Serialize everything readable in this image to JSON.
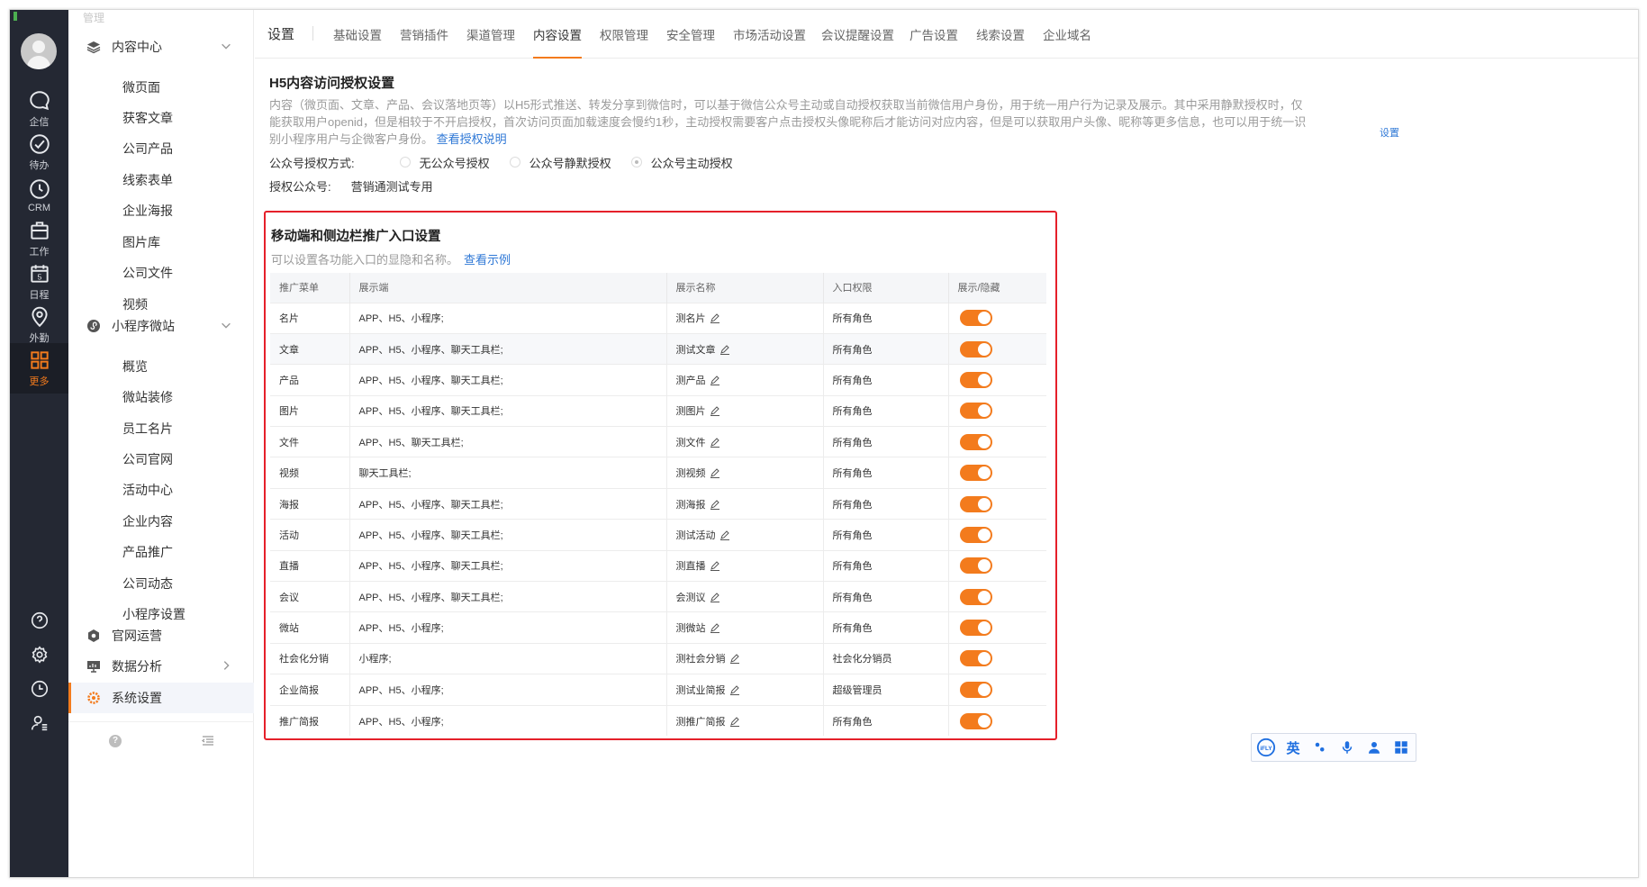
{
  "rail": {
    "items": [
      {
        "label": "企信",
        "icon": "chat-icon"
      },
      {
        "label": "待办",
        "icon": "check-circle-icon"
      },
      {
        "label": "CRM",
        "icon": "clock-icon"
      },
      {
        "label": "工作",
        "icon": "briefcase-icon"
      },
      {
        "label": "日程",
        "icon": "calendar-icon"
      },
      {
        "label": "外勤",
        "icon": "location-icon"
      },
      {
        "label": "更多",
        "icon": "grid-icon"
      }
    ],
    "calendar_day": "5",
    "bottom_icons": [
      "help-icon",
      "settings-icon",
      "history-icon",
      "user-manage-icon"
    ]
  },
  "sidebar": {
    "top_fade": "管理",
    "groups": {
      "content_center": "内容中心",
      "mini_site": "小程序微站",
      "official_ops": "官网运营",
      "data_analysis": "数据分析",
      "system_settings": "系统设置"
    },
    "content_items": [
      "微页面",
      "获客文章",
      "公司产品",
      "线索表单",
      "企业海报",
      "图片库",
      "公司文件",
      "视频"
    ],
    "mini_items": [
      "概览",
      "微站装修",
      "员工名片",
      "公司官网",
      "活动中心",
      "企业内容",
      "产品推广",
      "公司动态",
      "小程序设置"
    ]
  },
  "tabs": {
    "title": "设置",
    "items": [
      "基础设置",
      "营销插件",
      "渠道管理",
      "内容设置",
      "权限管理",
      "安全管理",
      "市场活动设置",
      "会议提醒设置",
      "广告设置",
      "线索设置",
      "企业域名"
    ],
    "active": "内容设置"
  },
  "h5": {
    "title": "H5内容访问授权设置",
    "desc": "内容（微页面、文章、产品、会议落地页等）以H5形式推送、转发分享到微信时，可以基于微信公众号主动或自动授权获取当前微信用户身份，用于统一用户行为记录及展示。其中采用静默授权时，仅能获取用户openid，但是相较于不开启授权，首次访问页面加载速度会慢约1秒，主动授权需要客户点击授权头像昵称后才能访问对应内容，但是可以获取用户头像、昵称等更多信息，也可以用于统一识别小程序用户与企微客户身份。",
    "desc_link": "查看授权说明",
    "right_link": "设置",
    "auth_label": "公众号授权方式:",
    "options": [
      "无公众号授权",
      "公众号静默授权",
      "公众号主动授权"
    ],
    "selected_option": "公众号主动授权",
    "account_label": "授权公众号:",
    "account_value": "营销通测试专用"
  },
  "panel": {
    "title": "移动端和侧边栏推广入口设置",
    "desc": "可以设置各功能入口的显隐和名称。",
    "desc_link": "查看示例",
    "columns": [
      "推广菜单",
      "展示端",
      "展示名称",
      "入口权限",
      "展示/隐藏"
    ],
    "rows": [
      {
        "menu": "名片",
        "clients": "APP、H5、小程序;",
        "name": "测名片",
        "perm": "所有角色",
        "on": true
      },
      {
        "menu": "文章",
        "clients": "APP、H5、小程序、聊天工具栏;",
        "name": "测试文章",
        "perm": "所有角色",
        "on": true
      },
      {
        "menu": "产品",
        "clients": "APP、H5、小程序、聊天工具栏;",
        "name": "测产品",
        "perm": "所有角色",
        "on": true
      },
      {
        "menu": "图片",
        "clients": "APP、H5、小程序、聊天工具栏;",
        "name": "测图片",
        "perm": "所有角色",
        "on": true
      },
      {
        "menu": "文件",
        "clients": "APP、H5、聊天工具栏;",
        "name": "测文件",
        "perm": "所有角色",
        "on": true
      },
      {
        "menu": "视频",
        "clients": "聊天工具栏;",
        "name": "测视频",
        "perm": "所有角色",
        "on": true
      },
      {
        "menu": "海报",
        "clients": "APP、H5、小程序、聊天工具栏;",
        "name": "测海报",
        "perm": "所有角色",
        "on": true
      },
      {
        "menu": "活动",
        "clients": "APP、H5、小程序、聊天工具栏;",
        "name": "测试活动",
        "perm": "所有角色",
        "on": true
      },
      {
        "menu": "直播",
        "clients": "APP、H5、小程序、聊天工具栏;",
        "name": "测直播",
        "perm": "所有角色",
        "on": true
      },
      {
        "menu": "会议",
        "clients": "APP、H5、小程序、聊天工具栏;",
        "name": "会测议",
        "perm": "所有角色",
        "on": true
      },
      {
        "menu": "微站",
        "clients": "APP、H5、小程序;",
        "name": "测微站",
        "perm": "所有角色",
        "on": true
      },
      {
        "menu": "社会化分销",
        "clients": "小程序;",
        "name": "测社会分销",
        "perm": "社会化分销员",
        "on": true
      },
      {
        "menu": "企业简报",
        "clients": "APP、H5、小程序;",
        "name": "测试业简报",
        "perm": "超级管理员",
        "on": true
      },
      {
        "menu": "推广简报",
        "clients": "APP、H5、小程序;",
        "name": "测推广简报",
        "perm": "所有角色",
        "on": true
      }
    ]
  },
  "ime": {
    "cn_en": "英"
  },
  "colors": {
    "accent": "#f37b1d",
    "rail_bg": "#242833",
    "link": "#2f78d6",
    "highlight_border": "#e5202a"
  }
}
